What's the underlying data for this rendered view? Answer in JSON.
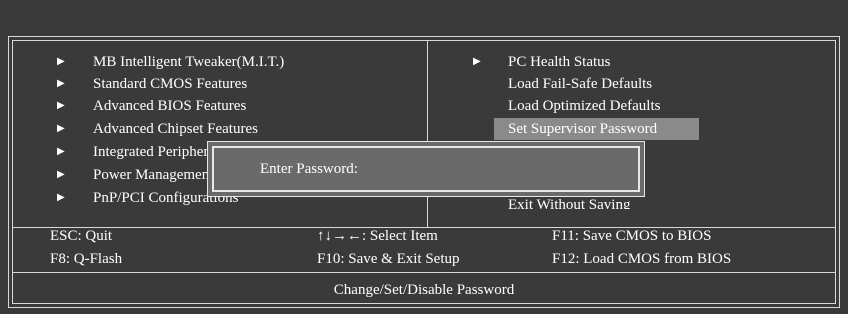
{
  "left_menu": [
    {
      "label": "MB Intelligent Tweaker(M.I.T.)"
    },
    {
      "label": "Standard CMOS Features"
    },
    {
      "label": "Advanced BIOS Features"
    },
    {
      "label": "Advanced Chipset Features"
    },
    {
      "label": "Integrated Peripherals"
    },
    {
      "label": "Power Management Setup"
    },
    {
      "label": "PnP/PCI Configurations"
    }
  ],
  "right_menu": [
    {
      "label": "PC Health Status",
      "has_arrow": true
    },
    {
      "label": "Load Fail-Safe Defaults",
      "has_arrow": false
    },
    {
      "label": "Load Optimized Defaults",
      "has_arrow": false
    },
    {
      "label": "Set Supervisor Password",
      "has_arrow": false,
      "selected": true
    },
    {
      "label": "Exit Without Saving",
      "has_arrow": false
    }
  ],
  "arrow_glyph": "▶",
  "footer": {
    "row1": {
      "col1": "ESC: Quit",
      "col2": "↑↓→←: Select Item",
      "col3": "F11: Save CMOS to BIOS"
    },
    "row2": {
      "col1": "F8: Q-Flash",
      "col2": "F10: Save & Exit Setup",
      "col3": "F12: Load CMOS from BIOS"
    },
    "status": "Change/Set/Disable Password"
  },
  "dialog": {
    "label": "Enter Password:"
  },
  "colors": {
    "background": "#3a3a3a",
    "highlight": "#8a8a8a",
    "dialog": "#6a6a6a",
    "text": "#ffffff"
  }
}
